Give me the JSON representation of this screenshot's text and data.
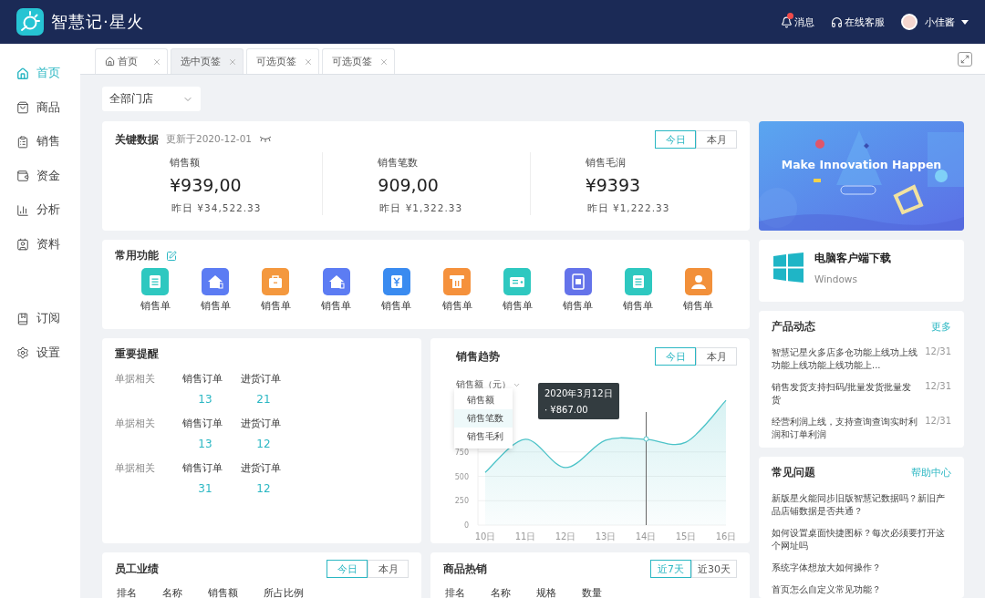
{
  "header": {
    "brand": "智慧记·星火",
    "actions": [
      {
        "kind": "bell",
        "label": "消息",
        "unread": true
      },
      {
        "kind": "headset",
        "label": "在线客服",
        "unread": false
      }
    ],
    "user": {
      "name": "小佳酱"
    }
  },
  "sidebar": {
    "items": [
      {
        "kind": "home",
        "label": "首页",
        "selected": true
      },
      {
        "kind": "bag",
        "label": "商品",
        "selected": false
      },
      {
        "kind": "clipboard",
        "label": "销售",
        "selected": false
      },
      {
        "kind": "wallet",
        "label": "资金",
        "selected": false
      },
      {
        "kind": "chart",
        "label": "分析",
        "selected": false
      },
      {
        "kind": "contact",
        "label": "资料",
        "selected": false
      }
    ],
    "bottom_items": [
      {
        "kind": "bookmark",
        "label": "订阅",
        "selected": false
      },
      {
        "kind": "gear",
        "label": "设置",
        "selected": false
      }
    ]
  },
  "tabs": [
    {
      "kind": "home",
      "label": "首页",
      "selected": false
    },
    {
      "kind": "plain",
      "label": "选中页签",
      "selected": true
    },
    {
      "kind": "plain",
      "label": "可选页签",
      "selected": false
    },
    {
      "kind": "plain",
      "label": "可选页签",
      "selected": false
    }
  ],
  "store_select": {
    "value": "全部门店"
  },
  "key_data": {
    "title": "关键数据",
    "updated": "更新于2020-12-01",
    "range": [
      {
        "label": "今日",
        "selected": true
      },
      {
        "label": "本月",
        "selected": false
      }
    ],
    "metrics": [
      {
        "label": "销售额",
        "value": "¥939,00",
        "yesterday": "昨日 ¥34,522.33"
      },
      {
        "label": "销售笔数",
        "value": "909,00",
        "yesterday": "昨日 ¥1,322.33"
      },
      {
        "label": "销售毛润",
        "value": "¥9393",
        "yesterday": "昨日 ¥1,222.33"
      }
    ]
  },
  "functions": {
    "title": "常用功能",
    "items": [
      {
        "kind": "doc",
        "label": "销售单",
        "color": "#2ec8c0"
      },
      {
        "kind": "house",
        "label": "销售单",
        "color": "#5c7cf3"
      },
      {
        "kind": "bag",
        "label": "销售单",
        "color": "#f4983e"
      },
      {
        "kind": "house",
        "label": "销售单",
        "color": "#5c7cf3"
      },
      {
        "kind": "yen",
        "label": "销售单",
        "color": "#3a8bf0"
      },
      {
        "kind": "receipt",
        "label": "销售单",
        "color": "#f5913c"
      },
      {
        "kind": "wallet",
        "label": "销售单",
        "color": "#2ec8c0"
      },
      {
        "kind": "refund",
        "label": "销售单",
        "color": "#6473ea"
      },
      {
        "kind": "doc",
        "label": "销售单",
        "color": "#2ec8c0"
      },
      {
        "kind": "person",
        "label": "销售单",
        "color": "#f2903a"
      }
    ]
  },
  "reminders": {
    "title": "重要提醒",
    "rows": [
      {
        "label": "单据相关",
        "cols": [
          {
            "name": "销售订单",
            "count": "13"
          },
          {
            "name": "进货订单",
            "count": "21"
          }
        ]
      },
      {
        "label": "单据相关",
        "cols": [
          {
            "name": "销售订单",
            "count": "13"
          },
          {
            "name": "进货订单",
            "count": "12"
          }
        ]
      },
      {
        "label": "单据相关",
        "cols": [
          {
            "name": "销售订单",
            "count": "31"
          },
          {
            "name": "进货订单",
            "count": "12"
          }
        ]
      }
    ]
  },
  "trend": {
    "title": "销售趋势",
    "range": [
      {
        "label": "今日",
        "selected": true
      },
      {
        "label": "本月",
        "selected": false
      }
    ],
    "metric_select": "销售额（元）",
    "menu": [
      {
        "label": "销售额",
        "selected": false
      },
      {
        "label": "销售笔数",
        "selected": true
      },
      {
        "label": "销售毛利",
        "selected": false
      }
    ],
    "chart_data": {
      "type": "area",
      "categories": [
        "10日",
        "11日",
        "12日",
        "13日",
        "14日",
        "15日",
        "16日"
      ],
      "series": [
        {
          "color": "#4cc3c8",
          "values": [
            540,
            880,
            590,
            870,
            880,
            850,
            1280
          ]
        }
      ],
      "ylim": [
        0,
        1300
      ],
      "yticks": [
        0,
        250,
        500,
        750
      ],
      "grid": true,
      "annotations": [
        "2020年3月12日"
      ]
    },
    "tooltip_value": "· ¥867.00"
  },
  "employees": {
    "title": "员工业绩",
    "range": [
      {
        "label": "今日",
        "selected": true
      },
      {
        "label": "本月",
        "selected": false
      }
    ],
    "columns": [
      "排名",
      "名称",
      "销售额",
      "所占比例"
    ]
  },
  "hot_products": {
    "title": "商品热销",
    "range": [
      {
        "label": "近7天",
        "selected": true
      },
      {
        "label": "近30天",
        "selected": false
      }
    ],
    "columns": [
      "排名",
      "名称",
      "规格",
      "数量"
    ]
  },
  "banner": {
    "kind": "picture",
    "title": "Make Innovation Happen"
  },
  "download": {
    "title": "电脑客户端下载",
    "platform": "Windows"
  },
  "news": {
    "title": "产品动态",
    "more": "更多",
    "items": [
      {
        "text": "智慧记星火多店多仓功能上线功上线功能上线功能上线功能上...",
        "date": "12/31"
      },
      {
        "text": "销售发货支持扫码/批量发货批量发货",
        "date": "12/31"
      },
      {
        "text": "经营利润上线，支持查询查询实时利润和订单利润",
        "date": "12/31"
      }
    ]
  },
  "faq": {
    "title": "常见问题",
    "more": "帮助中心",
    "items": [
      "新版星火能同步旧版智慧记数据吗？新旧产品店铺数据是否共通？",
      "如何设置桌面快捷图标？每次必须要打开这个网址吗",
      "系统字体想放大如何操作？",
      "首页怎么自定义常见功能？"
    ]
  }
}
